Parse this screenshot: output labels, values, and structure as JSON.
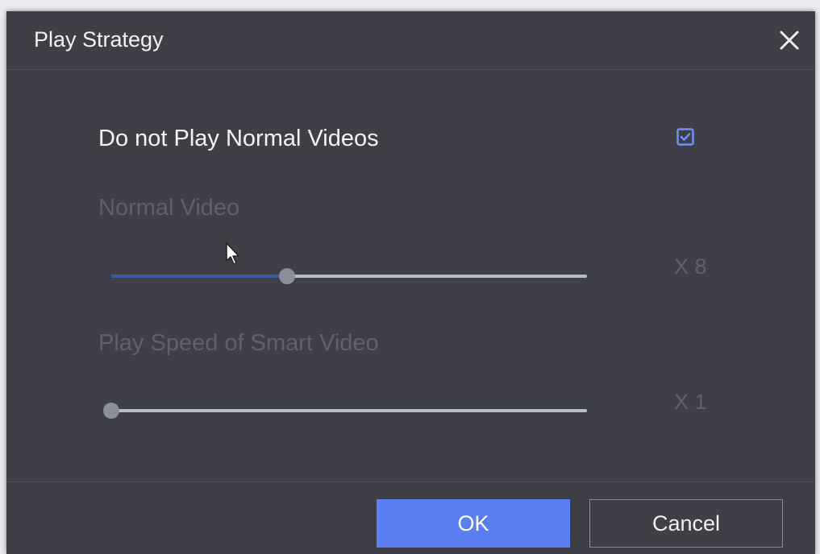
{
  "dialog": {
    "title": "Play Strategy",
    "close_icon": "close-icon"
  },
  "option": {
    "label": "Do not Play Normal Videos",
    "checked": true
  },
  "normal_video": {
    "label": "Normal Video",
    "value_text": "X 8",
    "slider_fraction": 0.37
  },
  "smart_video": {
    "label": "Play Speed of Smart Video",
    "value_text": "X 1",
    "slider_fraction": 0.0
  },
  "buttons": {
    "ok_label": "OK",
    "cancel_label": "Cancel"
  },
  "colors": {
    "dialog_bg": "#3e3f47",
    "accent": "#5b7ef2",
    "checkbox": "#6f8ff5",
    "slider_fill": "#3e5a99",
    "disabled_text": "#5f6068"
  }
}
